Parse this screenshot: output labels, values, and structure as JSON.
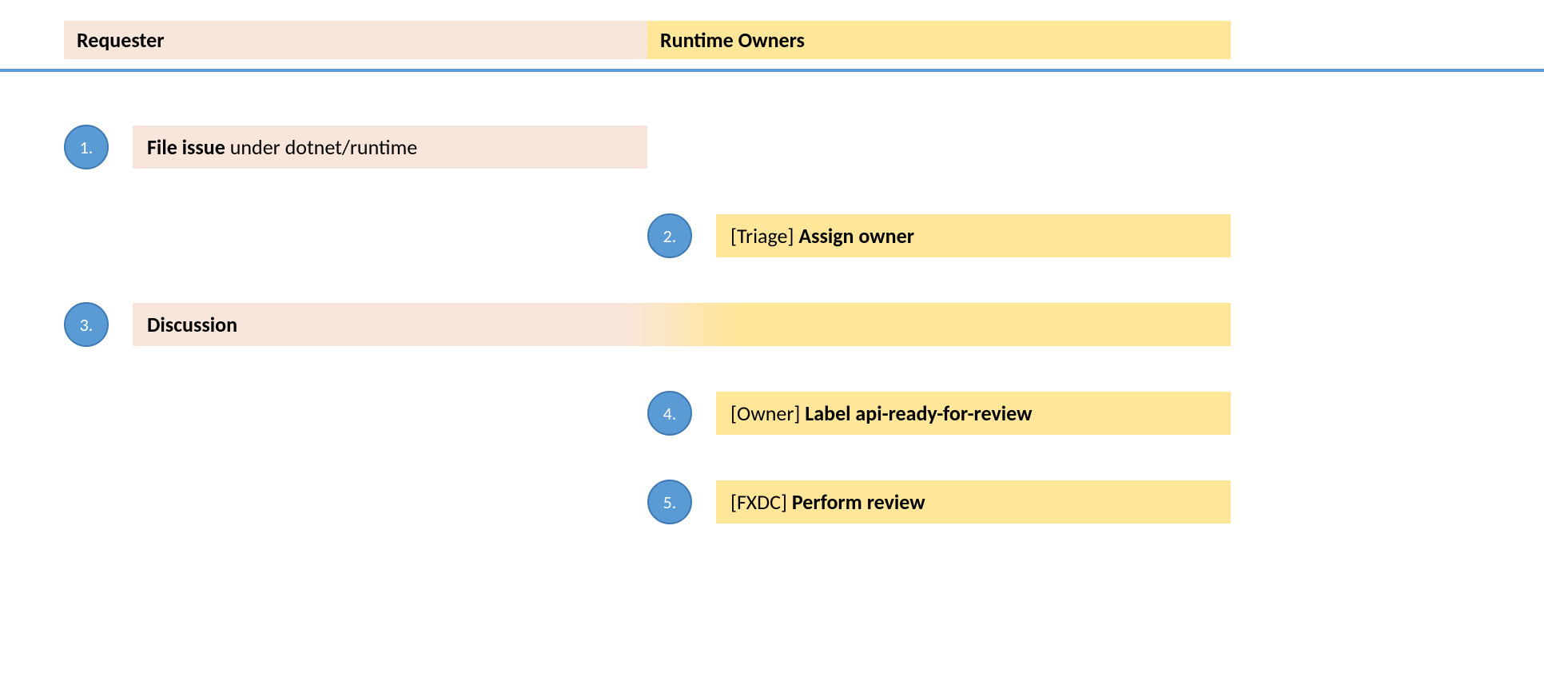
{
  "headers": {
    "left": "Requester",
    "right": "Runtime Owners"
  },
  "steps": {
    "s1": {
      "num": "1.",
      "bold": "File issue",
      "rest": " under dotnet/runtime"
    },
    "s2": {
      "num": "2.",
      "prefix": "[Triage] ",
      "bold": "Assign owner"
    },
    "s3": {
      "num": "3.",
      "bold": "Discussion"
    },
    "s4": {
      "num": "4.",
      "prefix": "[Owner] ",
      "bold": "Label api-ready-for-review"
    },
    "s5": {
      "num": "5.",
      "prefix": "[FXDC] ",
      "bold": "Perform review"
    }
  }
}
